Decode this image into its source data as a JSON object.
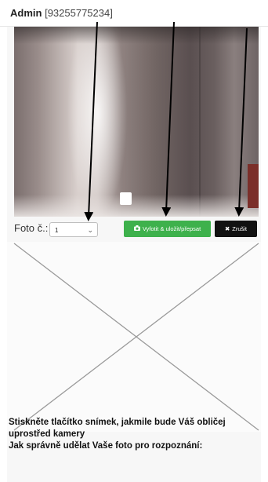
{
  "header": {
    "user": "Admin",
    "user_id": "[93255775234]"
  },
  "camera": {
    "feed_label": "camera-preview"
  },
  "controls": {
    "foto_label": "Foto č.:",
    "foto_selected": "1",
    "capture_icon": "camera-icon",
    "capture_label": "Vyfotit & uložit/přepsat",
    "cancel_icon": "close-icon",
    "cancel_label": "Zrušit"
  },
  "instructions": {
    "line1": "Stiskněte tlačítko snímek, jakmile bude Váš obličej uprostřed kamery",
    "line2": "Jak správně udělat Vaše foto pro rozpoznání:"
  },
  "colors": {
    "capture_button": "#3eb14c",
    "cancel_button": "#111111"
  }
}
